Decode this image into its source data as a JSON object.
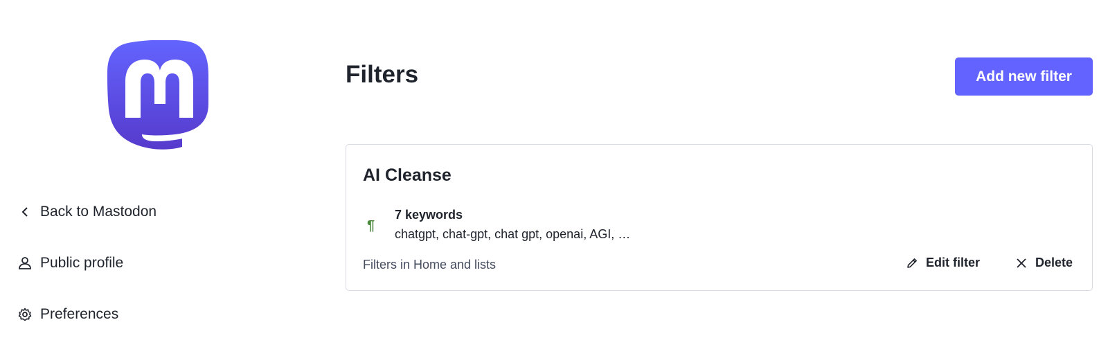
{
  "brand": {
    "logo_icon": "mastodon-logo-icon",
    "color": "#6364ff"
  },
  "sidebar": {
    "items": [
      {
        "label": "Back to Mastodon",
        "icon": "chevron-left-icon"
      },
      {
        "label": "Public profile",
        "icon": "person-icon"
      },
      {
        "label": "Preferences",
        "icon": "gear-icon"
      }
    ]
  },
  "main": {
    "title": "Filters",
    "add_button_label": "Add new filter"
  },
  "filter_card": {
    "title": "AI Cleanse",
    "keyword_icon": "pilcrow-icon",
    "keyword_count": "7 keywords",
    "keywords": "chatgpt, chat-gpt, chat gpt, openai, AGI, …",
    "context": "Filters in Home and lists",
    "edit_label": "Edit filter",
    "delete_label": "Delete"
  }
}
